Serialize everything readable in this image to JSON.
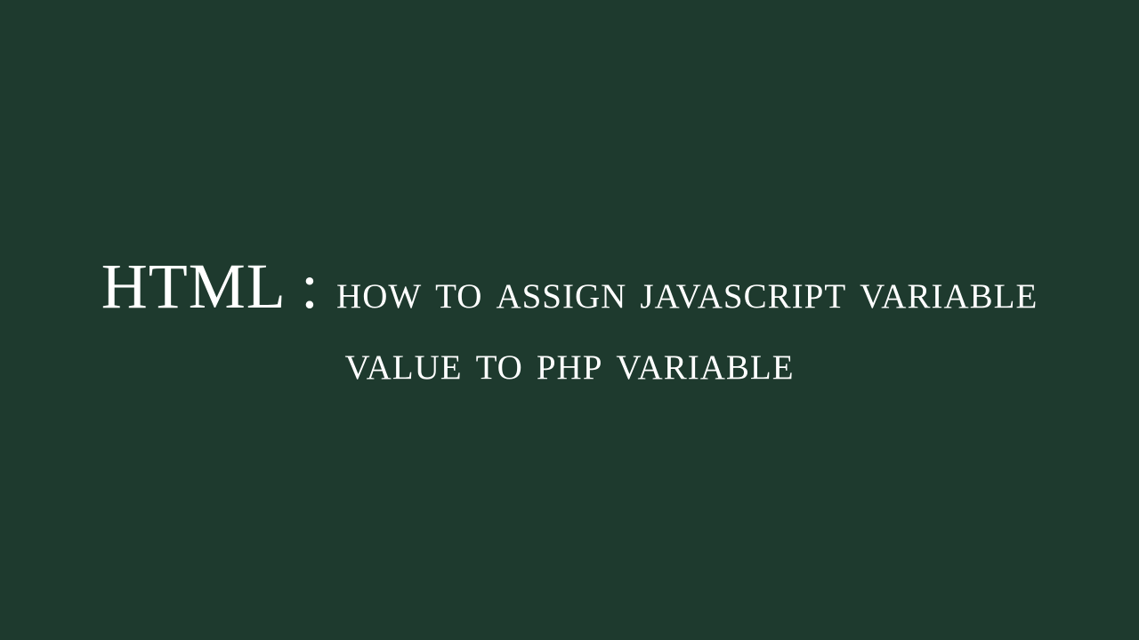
{
  "title": {
    "prefix": "HTML : ",
    "main": "how to assign javascript variable value to php variable"
  },
  "colors": {
    "background": "#1e3a2e",
    "text": "#ffffff"
  }
}
